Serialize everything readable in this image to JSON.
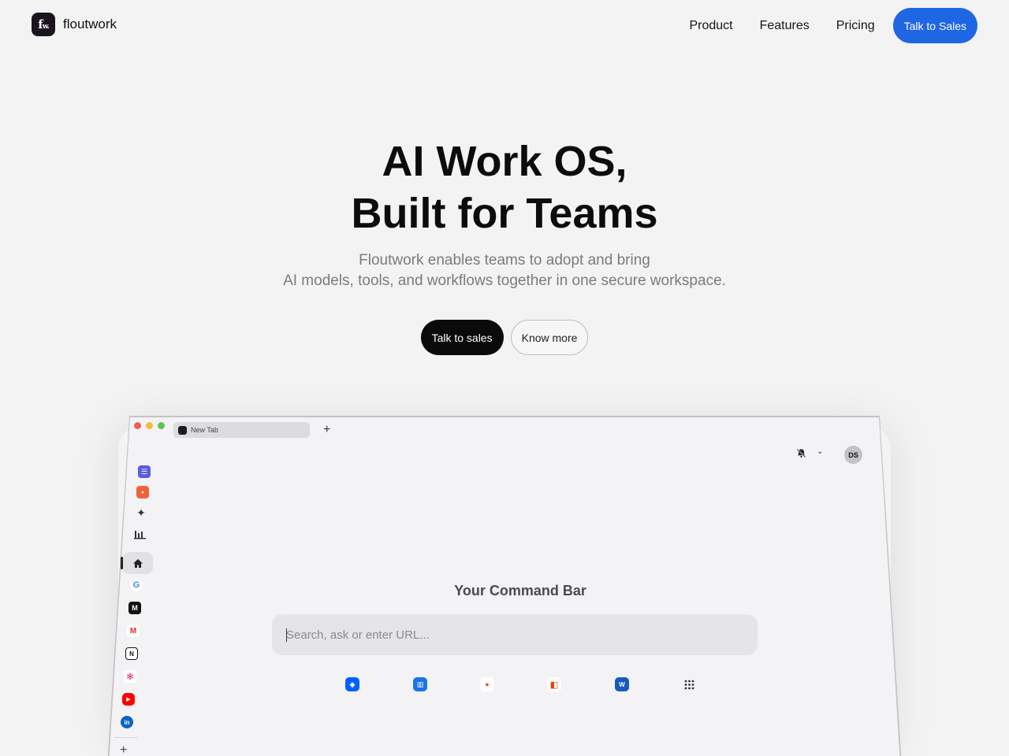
{
  "brand": {
    "logo_text": "fw.",
    "name": "floutwork"
  },
  "nav": {
    "links": [
      "Product",
      "Features",
      "Pricing"
    ],
    "cta": "Talk to Sales"
  },
  "hero": {
    "title_line1": "AI Work OS,",
    "title_line2": "Built for Teams",
    "sub_line1": "Floutwork enables teams to adopt and bring",
    "sub_line2": "AI models, tools, and workflows together in one secure workspace.",
    "primary_btn": "Talk to sales",
    "secondary_btn": "Know more"
  },
  "mockup": {
    "tab_label": "New Tab",
    "avatar_initials": "DS",
    "command_title": "Your Command Bar",
    "command_placeholder": "Search, ask or enter URL...",
    "sidebar_icons": [
      "tasks-icon",
      "notes-icon",
      "sparkle-ai-icon",
      "analytics-icon",
      "home-icon",
      "google-icon",
      "medium-icon",
      "gmail-icon",
      "notion-icon",
      "slack-icon",
      "youtube-icon",
      "linkedin-icon"
    ],
    "quick_apps": [
      "dropbox-icon",
      "trello-icon",
      "figma-icon",
      "office-icon",
      "word-icon",
      "apps-grid-icon"
    ]
  },
  "colors": {
    "accent": "#1f66e5",
    "background": "#f3f3f4",
    "dark_button": "#0a0a0a"
  }
}
